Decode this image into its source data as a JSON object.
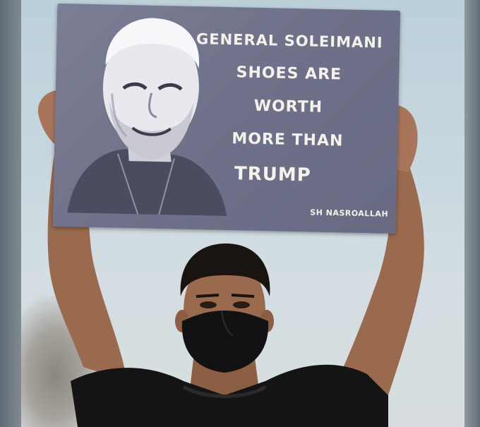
{
  "sign": {
    "lines": [
      "GENERAL SOLEIMANI",
      "SHOES ARE",
      "WORTH",
      "MORE THAN",
      "TRUMP"
    ],
    "credit": "SH NASROALLAH"
  },
  "colors": {
    "sky": "#c6d6de",
    "sign": "#71748c",
    "sign_text": "#f4f2ea",
    "shirt": "#141414",
    "skin": "#9a6a4e"
  },
  "icons": {
    "portrait": "portrait-illustration",
    "mask": "face-mask"
  }
}
